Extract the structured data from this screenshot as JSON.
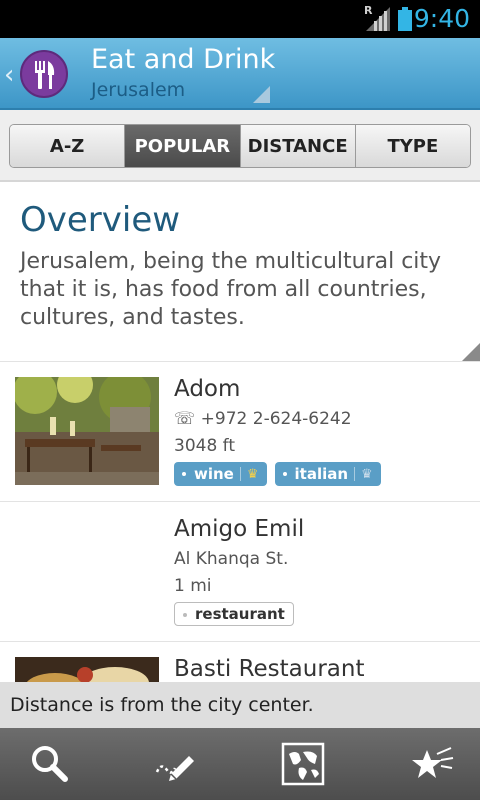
{
  "status_bar": {
    "time": "9:40",
    "signal_label": "R",
    "accent_color": "#33b5e5"
  },
  "header": {
    "title": "Eat and Drink",
    "subtitle": "Jerusalem",
    "icon": "fork-knife-icon",
    "back_icon": "chevron-left-icon"
  },
  "tabs": [
    {
      "label": "A-Z",
      "active": false
    },
    {
      "label": "POPULAR",
      "active": true
    },
    {
      "label": "DISTANCE",
      "active": false
    },
    {
      "label": "TYPE",
      "active": false
    }
  ],
  "overview": {
    "title": "Overview",
    "text": "Jerusalem, being the multicultural city that it is, has food from all countries, cultures, and tastes."
  },
  "items": [
    {
      "name": "Adom",
      "line1": "☏ +972 2-624-6242",
      "line2": "3048 ft",
      "tags": [
        {
          "label": "wine",
          "style": "blue",
          "crown": true
        },
        {
          "label": "italian",
          "style": "blue",
          "crown": true
        }
      ]
    },
    {
      "name": "Amigo Emil",
      "line1": "Al Khanqa St.",
      "line2": "1 mi",
      "tags": [
        {
          "label": "restaurant",
          "style": "plain",
          "crown": false
        }
      ]
    },
    {
      "name": "Basti Restaurant"
    }
  ],
  "toast": {
    "text": "Distance is from the city center."
  },
  "bottom_bar": {
    "buttons": [
      "search-icon",
      "pencil-icon",
      "map-icon",
      "star-icon"
    ]
  }
}
